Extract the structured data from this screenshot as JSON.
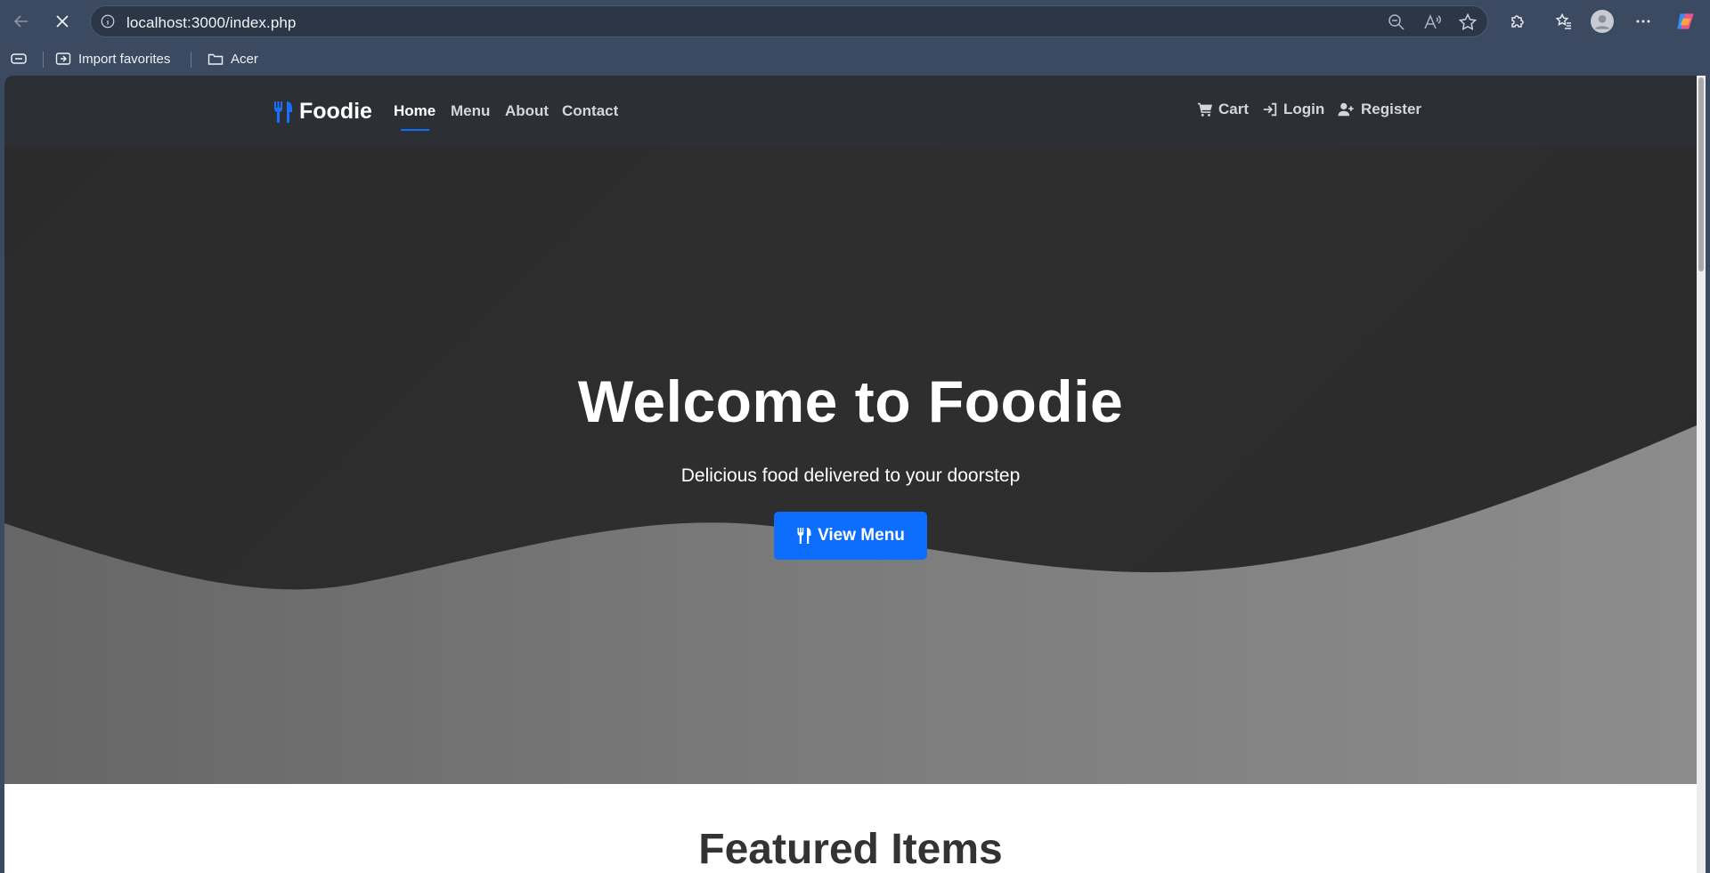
{
  "browser": {
    "url": "localhost:3000/index.php",
    "favorites": [
      {
        "label": "Import favorites",
        "icon": "import-icon"
      },
      {
        "label": "Acer",
        "icon": "folder-icon"
      }
    ]
  },
  "site": {
    "brand": "Foodie",
    "nav": [
      {
        "label": "Home",
        "active": true
      },
      {
        "label": "Menu",
        "active": false
      },
      {
        "label": "About",
        "active": false
      },
      {
        "label": "Contact",
        "active": false
      }
    ],
    "nav_right": [
      {
        "label": "Cart",
        "icon": "cart-icon"
      },
      {
        "label": "Login",
        "icon": "login-icon"
      },
      {
        "label": "Register",
        "icon": "user-plus-icon"
      }
    ],
    "accent_color": "#0d6efd"
  },
  "hero": {
    "title": "Welcome to Foodie",
    "subtitle": "Delicious food delivered to your doorstep",
    "button_label": "View Menu"
  },
  "featured": {
    "title": "Featured Items"
  }
}
